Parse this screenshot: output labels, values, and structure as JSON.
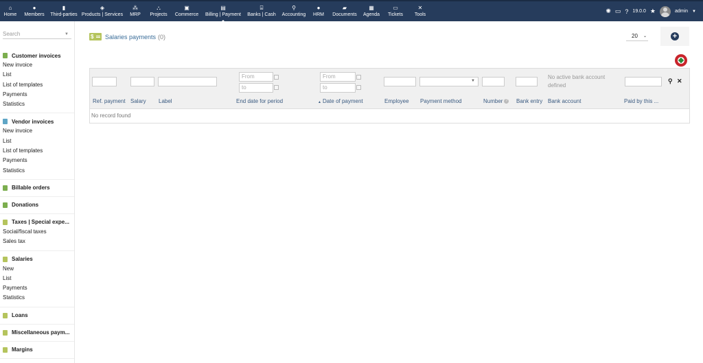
{
  "topmenu": [
    {
      "label": "Home",
      "icon": "home-icon",
      "glyph": "⌂"
    },
    {
      "label": "Members",
      "icon": "members-icon",
      "glyph": "●"
    },
    {
      "label": "Third-parties",
      "icon": "building-icon",
      "glyph": "▮"
    },
    {
      "label": "Products | Services",
      "icon": "cube-icon",
      "glyph": "◈"
    },
    {
      "label": "MRP",
      "icon": "cubes-icon",
      "glyph": "⁂"
    },
    {
      "label": "Projects",
      "icon": "sitemap-icon",
      "glyph": "⛬"
    },
    {
      "label": "Commerce",
      "icon": "suitcase-icon",
      "glyph": "▣"
    },
    {
      "label": "Billing | Payment",
      "icon": "invoice-icon",
      "glyph": "▤"
    },
    {
      "label": "Banks | Cash",
      "icon": "bank-icon",
      "glyph": "⌸"
    },
    {
      "label": "Accounting",
      "icon": "search-dollar-icon",
      "glyph": "⚲"
    },
    {
      "label": "HRM",
      "icon": "user-tie-icon",
      "glyph": "●"
    },
    {
      "label": "Documents",
      "icon": "folder-icon",
      "glyph": "▰"
    },
    {
      "label": "Agenda",
      "icon": "calendar-icon",
      "glyph": "▦"
    },
    {
      "label": "Tickets",
      "icon": "ticket-icon",
      "glyph": "▭"
    },
    {
      "label": "Tools",
      "icon": "tools-icon",
      "glyph": "✕"
    }
  ],
  "topright": {
    "version": "19.0.0",
    "username": "admin"
  },
  "sidebar": {
    "search_placeholder": "Search",
    "blocks": [
      {
        "title": "Customer invoices",
        "color": "#7cae4f",
        "items": [
          "New invoice",
          "List",
          "List of templates",
          "Payments",
          "Statistics"
        ]
      },
      {
        "title": "Vendor invoices",
        "color": "#5fa6c6",
        "items": [
          "New invoice",
          "List",
          "List of templates",
          "Payments",
          "Statistics"
        ]
      },
      {
        "title": "Billable orders",
        "color": "#7cae4f",
        "items": []
      },
      {
        "title": "Donations",
        "color": "#7cae4f",
        "items": []
      },
      {
        "title": "Taxes | Special expe...",
        "color": "#b5c45d",
        "items": [
          "Social/fiscal taxes",
          "Sales tax"
        ]
      },
      {
        "title": "Salaries",
        "color": "#b5c45d",
        "items": [
          "New",
          "List",
          "Payments",
          "Statistics"
        ]
      },
      {
        "title": "Loans",
        "color": "#b5c45d",
        "items": []
      },
      {
        "title": "Miscellaneous paym...",
        "color": "#b5c45d",
        "items": []
      },
      {
        "title": "Margins",
        "color": "#b5c45d",
        "items": []
      }
    ]
  },
  "main": {
    "title": "Salaries payments",
    "count": "(0)",
    "limit": "20",
    "add_button": "+",
    "filters": {
      "from_placeholder": "From",
      "to_placeholder": "to",
      "no_bank": "No active bank account defined"
    },
    "columns": [
      "Ref. payment",
      "Salary",
      "Label",
      "End date for period",
      "Date of payment",
      "Employee",
      "Payment method",
      "Number",
      "Bank entry",
      "Bank account",
      "Paid by this ..."
    ],
    "sort_indicator": "▲",
    "empty_text": "No record found"
  }
}
